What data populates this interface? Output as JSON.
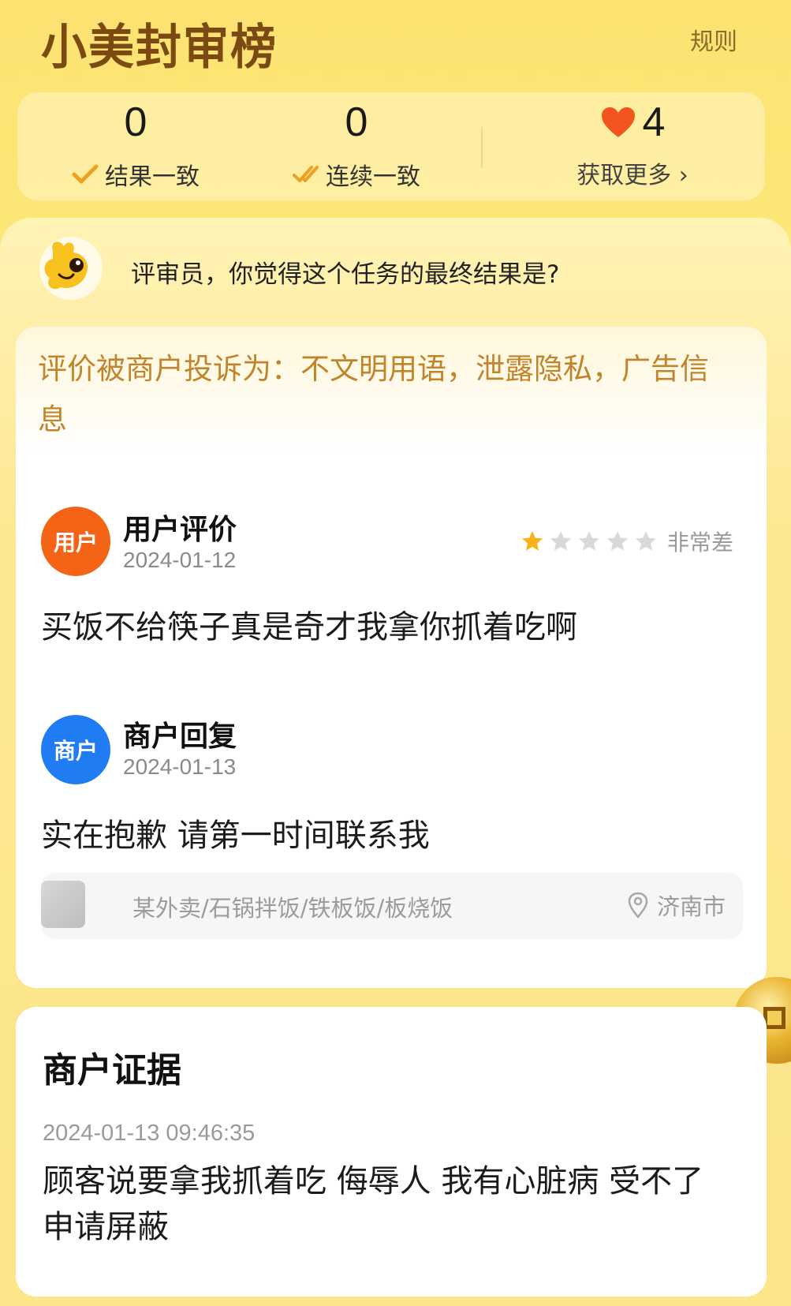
{
  "header": {
    "title": "小美封审榜",
    "rules_label": "规则"
  },
  "stats": {
    "consistent_result": {
      "value": "0",
      "label": "结果一致"
    },
    "streak_consistent": {
      "value": "0",
      "label": "连续一致"
    },
    "hearts": {
      "value": "4",
      "label": "获取更多 ›"
    }
  },
  "question": {
    "text": "评审员，你觉得这个任务的最终结果是?"
  },
  "complaint": {
    "line1": "评价被商户投诉为：不文明用语，泄露隐私，广告信",
    "line2": "息"
  },
  "review": {
    "avatar_label": "用户",
    "title": "用户评价",
    "date": "2024-01-12",
    "rating": 1,
    "rating_max": 5,
    "rating_label": "非常差",
    "text": "买饭不给筷子真是奇才我拿你抓着吃啊"
  },
  "reply": {
    "avatar_label": "商户",
    "title": "商户回复",
    "date": "2024-01-13",
    "text": "实在抱歉 请第一时间联系我"
  },
  "store": {
    "name": "某外卖/石锅拌饭/铁板饭/板烧饭",
    "location": "济南市"
  },
  "evidence": {
    "title": "商户证据",
    "time": "2024-01-13 09:46:35",
    "text": "顾客说要拿我抓着吃 侮辱人 我有心脏病 受不了 申请屏蔽"
  },
  "colors": {
    "accent_orange": "#f46417",
    "merchant_blue": "#1f7cf2",
    "complaint_text": "#c2842a",
    "background_yellow": "#fde272",
    "star_active": "#f6b21b",
    "star_inactive": "#d9d9d9"
  },
  "icons": {
    "check": "check-icon",
    "double_check": "double-check-icon",
    "heart": "heart-icon",
    "mascot": "mascot-icon",
    "star": "star-icon",
    "location": "location-icon",
    "coin": "coin-icon"
  }
}
